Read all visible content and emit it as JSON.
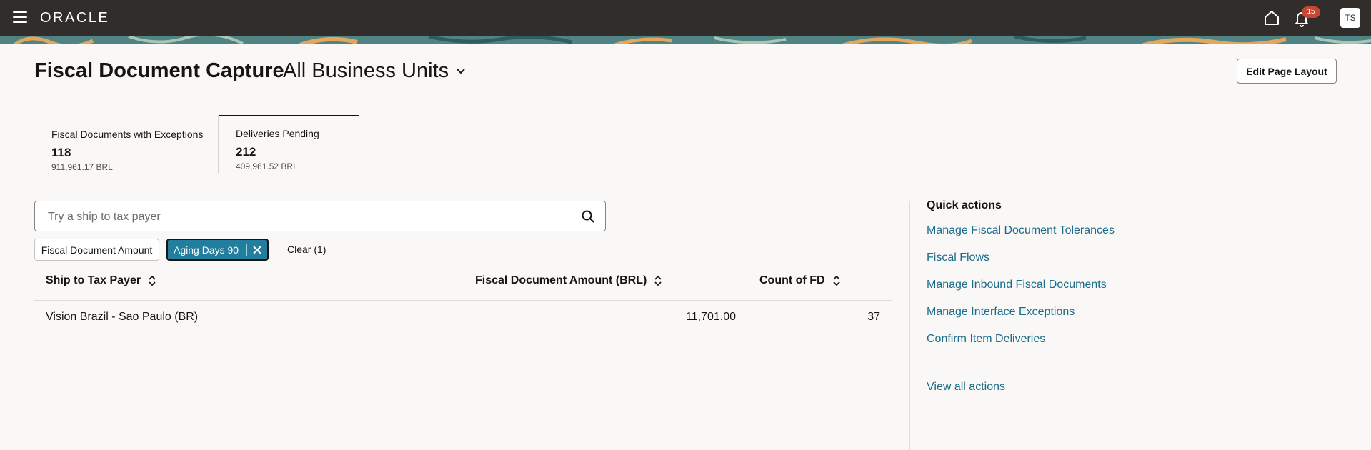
{
  "topbar": {
    "logo": "ORACLE",
    "notification_count": "15",
    "user_initials": "TS"
  },
  "header": {
    "title": "Fiscal Document Capture",
    "business_unit": "All Business Units",
    "edit_layout_label": "Edit Page Layout"
  },
  "metrics": [
    {
      "label": "Fiscal Documents with Exceptions",
      "count": "118",
      "amount": "911,961.17 BRL",
      "selected": false
    },
    {
      "label": "Deliveries Pending",
      "count": "212",
      "amount": "409,961.52 BRL",
      "selected": true
    }
  ],
  "search": {
    "placeholder": "Try a ship to tax payer",
    "value": ""
  },
  "filters": {
    "chips": [
      {
        "label": "Fiscal Document Amount",
        "active": false
      },
      {
        "label": "Aging Days 90",
        "active": true
      }
    ],
    "clear_label": "Clear (1)"
  },
  "table": {
    "columns": [
      "Ship to Tax Payer",
      "Fiscal Document Amount (BRL)",
      "Count of FD"
    ],
    "rows": [
      [
        "Vision Brazil - Sao Paulo (BR)",
        "11,701.00",
        "37"
      ]
    ]
  },
  "quick_actions": {
    "title": "Quick actions",
    "items": [
      "Manage Fiscal Document Tolerances",
      "Fiscal Flows",
      "Manage Inbound Fiscal Documents",
      "Manage Interface Exceptions",
      "Confirm Item Deliveries"
    ],
    "view_all": "View all actions"
  },
  "colors": {
    "topbar": "#312d2a",
    "accent_chip": "#227e9e",
    "link": "#1b6b8b",
    "badge": "#c74634"
  },
  "icons": [
    "hamburger-menu-icon",
    "home-icon",
    "bell-icon",
    "chevron-down-icon",
    "search-icon",
    "sort-icon",
    "close-icon"
  ]
}
